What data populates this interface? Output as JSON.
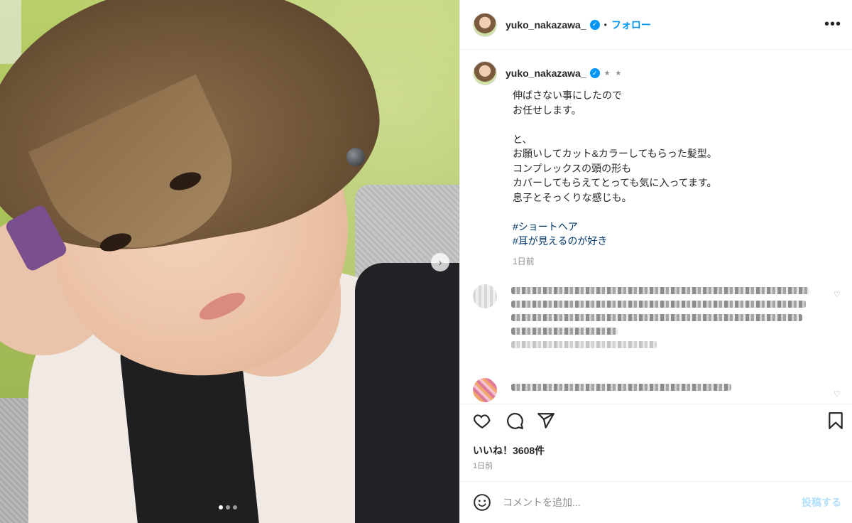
{
  "post": {
    "username": "yuko_nakazawa_",
    "follow_label": "フォロー",
    "header_separator": "•",
    "more_label": "•••",
    "photo_dots_count": 3,
    "photo_dots_active": 0,
    "next_label": "›"
  },
  "caption": {
    "username": "yuko_nakazawa_",
    "stars": "★ ★",
    "lines": [
      "伸ばさない事にしたので",
      "お任せします。",
      "",
      "と、",
      "お願いしてカット&カラーしてもらった髪型。",
      "コンプレックスの頭の形も",
      "カバーしてもらえてとっても気に入ってます。",
      "息子とそっくりな感じも。"
    ],
    "hashtags": [
      "#ショートヘア",
      "#耳が見えるのが好き"
    ],
    "time": "1日前"
  },
  "actions": {
    "like_icon": "heart-icon",
    "comment_icon": "comment-icon",
    "share_icon": "share-icon",
    "save_icon": "bookmark-icon"
  },
  "stats": {
    "likes": "いいね！3608件",
    "time": "1日前"
  },
  "comment_box": {
    "placeholder": "コメントを追加...",
    "post_label": "投稿する",
    "emoji_icon": "smiley-icon"
  },
  "colors": {
    "accent": "#0095f6",
    "text": "#262626",
    "muted": "#8e8e8e",
    "hashtag": "#00376b",
    "post_disabled": "#b2dffc"
  }
}
